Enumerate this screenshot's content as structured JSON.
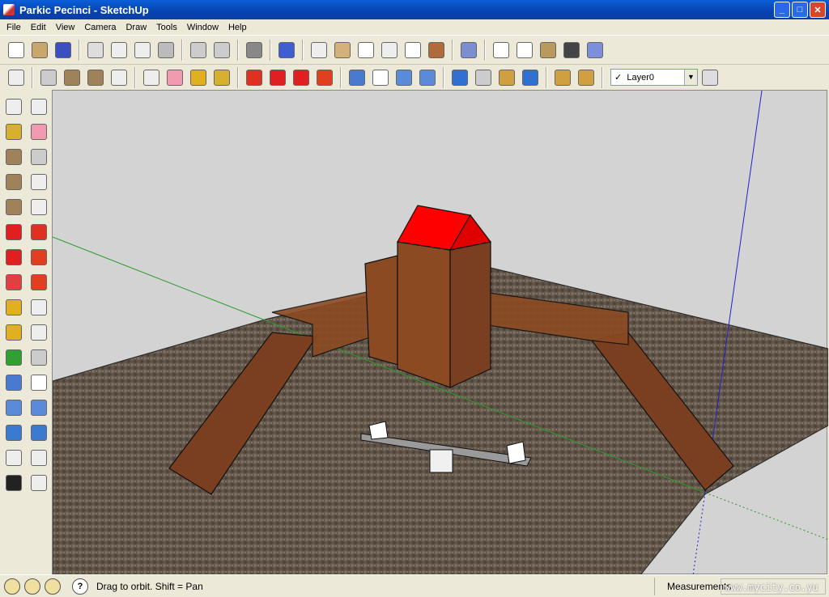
{
  "window": {
    "title": "Parkic Pecinci - SketchUp",
    "minimize": "_",
    "maximize": "□",
    "close": "✕"
  },
  "menu": [
    "File",
    "Edit",
    "View",
    "Camera",
    "Draw",
    "Tools",
    "Window",
    "Help"
  ],
  "toolbar1": [
    {
      "icon": "new-icon",
      "color": "#ffffff"
    },
    {
      "icon": "open-icon",
      "color": "#c9a66b"
    },
    {
      "icon": "save-icon",
      "color": "#3a4fc0"
    },
    "sep",
    {
      "icon": "cut-icon",
      "color": "#ddd"
    },
    {
      "icon": "copy-icon",
      "color": "#eee"
    },
    {
      "icon": "paste-icon",
      "color": "#eee"
    },
    {
      "icon": "erase-icon",
      "color": "#bbb"
    },
    "sep",
    {
      "icon": "undo-icon",
      "color": "#ccc"
    },
    {
      "icon": "redo-icon",
      "color": "#ccc"
    },
    "sep",
    {
      "icon": "print-icon",
      "color": "#888"
    },
    "sep",
    {
      "icon": "model-info-icon",
      "color": "#3d5fd0"
    },
    "sep",
    {
      "icon": "iso-view-icon",
      "color": "#eee"
    },
    {
      "icon": "top-view-icon",
      "color": "#d4b07a"
    },
    {
      "icon": "front-view-icon",
      "color": "#fff"
    },
    {
      "icon": "right-view-icon",
      "color": "#eee"
    },
    {
      "icon": "back-view-icon",
      "color": "#fff"
    },
    {
      "icon": "left-view-icon",
      "color": "#b06b3b"
    },
    "sep",
    {
      "icon": "xray-icon",
      "color": "#7c8ed0"
    },
    "sep",
    {
      "icon": "wireframe-icon",
      "color": "#fff"
    },
    {
      "icon": "hidden-line-icon",
      "color": "#fff"
    },
    {
      "icon": "shaded-icon",
      "color": "#b89a5c"
    },
    {
      "icon": "shaded-textures-icon",
      "color": "#444"
    },
    {
      "icon": "monochrome-icon",
      "color": "#7d8fd8"
    }
  ],
  "toolbar2": [
    {
      "icon": "select-icon",
      "color": "#eee"
    },
    "sep",
    {
      "icon": "pencil-icon",
      "color": "#ccc"
    },
    {
      "icon": "rectangle-icon",
      "color": "#a0825a"
    },
    {
      "icon": "circle-icon",
      "color": "#a0825a"
    },
    {
      "icon": "arc-icon",
      "color": "#eee"
    },
    "sep",
    {
      "icon": "make-component-icon",
      "color": "#eee"
    },
    {
      "icon": "eraser-icon",
      "color": "#f19ab0"
    },
    {
      "icon": "tape-measure-icon",
      "color": "#e0b020"
    },
    {
      "icon": "paint-bucket-icon",
      "color": "#d8b030"
    },
    "sep",
    {
      "icon": "push-pull-icon",
      "color": "#e03020"
    },
    {
      "icon": "move-icon",
      "color": "#e02020"
    },
    {
      "icon": "rotate-icon",
      "color": "#e02020"
    },
    {
      "icon": "follow-me-icon",
      "color": "#e04020"
    },
    "sep",
    {
      "icon": "orbit-icon",
      "color": "#4a7ad0"
    },
    {
      "icon": "pan-icon",
      "color": "#fff"
    },
    {
      "icon": "zoom-icon",
      "color": "#5a8ad8"
    },
    {
      "icon": "zoom-extents-icon",
      "color": "#5a8ad8"
    },
    "sep",
    {
      "icon": "get-location-icon",
      "color": "#3070d0"
    },
    {
      "icon": "toggle-terrain-icon",
      "color": "#ccc"
    },
    {
      "icon": "place-model-icon",
      "color": "#d0a040"
    },
    {
      "icon": "get-models-icon",
      "color": "#3070d0"
    },
    "sep",
    {
      "icon": "get-component-icon",
      "color": "#d0a040"
    },
    {
      "icon": "share-component-icon",
      "color": "#d0a040"
    }
  ],
  "layer": {
    "check": "✓",
    "name": "Layer0",
    "dropdown": "▼"
  },
  "layer_manager_icon": {
    "icon": "layer-manager-icon",
    "color": "#ddd"
  },
  "lefttools": [
    {
      "icon": "select-icon",
      "color": "#eee"
    },
    {
      "icon": "make-component-icon",
      "color": "#eee"
    },
    {
      "icon": "paint-bucket-icon",
      "color": "#d8b030"
    },
    {
      "icon": "eraser-icon",
      "color": "#f19ab0"
    },
    {
      "icon": "rectangle-icon",
      "color": "#a0825a"
    },
    {
      "icon": "line-icon",
      "color": "#ccc"
    },
    {
      "icon": "circle-icon",
      "color": "#a0825a"
    },
    {
      "icon": "arc-icon",
      "color": "#eee"
    },
    {
      "icon": "polygon-icon",
      "color": "#a0825a"
    },
    {
      "icon": "freehand-icon",
      "color": "#eee"
    },
    {
      "icon": "move-icon",
      "color": "#e02020"
    },
    {
      "icon": "push-pull-icon",
      "color": "#e03020"
    },
    {
      "icon": "rotate-icon",
      "color": "#e02020"
    },
    {
      "icon": "follow-me-icon",
      "color": "#e04020"
    },
    {
      "icon": "scale-icon",
      "color": "#e04040"
    },
    {
      "icon": "offset-icon",
      "color": "#e04020"
    },
    {
      "icon": "tape-measure-icon",
      "color": "#e0b020"
    },
    {
      "icon": "dimension-icon",
      "color": "#eee"
    },
    {
      "icon": "protractor-icon",
      "color": "#e0b020"
    },
    {
      "icon": "text-icon",
      "color": "#eee"
    },
    {
      "icon": "axes-icon",
      "color": "#30a030"
    },
    {
      "icon": "3d-text-icon",
      "color": "#ccc"
    },
    {
      "icon": "orbit-icon",
      "color": "#4a7ad0"
    },
    {
      "icon": "pan-icon",
      "color": "#fff"
    },
    {
      "icon": "zoom-icon",
      "color": "#5a8ad8"
    },
    {
      "icon": "zoom-window-icon",
      "color": "#5a8ad8"
    },
    {
      "icon": "previous-view-icon",
      "color": "#3a7ad0"
    },
    {
      "icon": "zoom-extents-icon",
      "color": "#3a7ad0"
    },
    {
      "icon": "position-camera-icon",
      "color": "#eee"
    },
    {
      "icon": "look-around-icon",
      "color": "#eee"
    },
    {
      "icon": "walk-icon",
      "color": "#222"
    },
    {
      "icon": "section-plane-icon",
      "color": "#eee"
    }
  ],
  "status": {
    "hint": "Drag to orbit.  Shift = Pan",
    "help": "?",
    "measurements_label": "Measurements",
    "watermark": "www.mycity.co.yu",
    "icons": [
      "geo-location-icon",
      "credits-icon",
      "user-icon"
    ]
  },
  "colors": {
    "roof": "#ff0000",
    "wood": "#8b4a22",
    "ground": "#5f5348",
    "sky": "#d3d3d3"
  }
}
